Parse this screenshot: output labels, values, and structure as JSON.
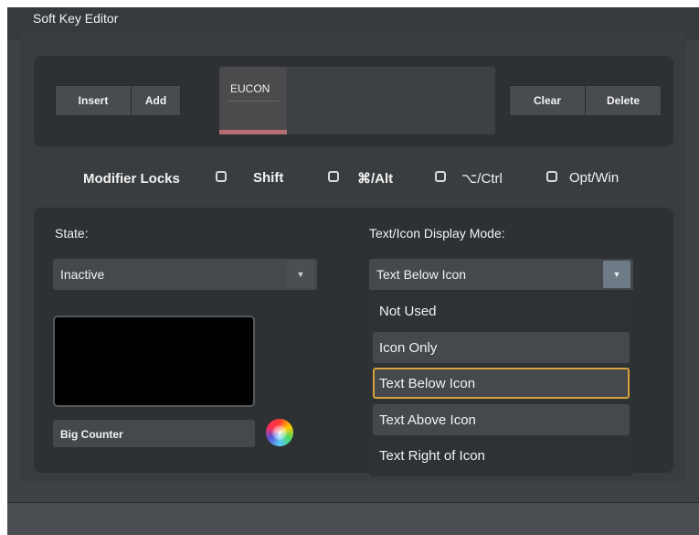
{
  "window": {
    "title": "Soft Key Editor"
  },
  "toolbar": {
    "insert_label": "Insert",
    "add_label": "Add",
    "clear_label": "Clear",
    "delete_label": "Delete"
  },
  "key_strip": {
    "active_key_label": "EUCON",
    "active_key_color": "#b56f74"
  },
  "modifier_locks": {
    "label": "Modifier Locks",
    "options": [
      {
        "label": "Shift",
        "checked": false
      },
      {
        "label": "⌘/Alt",
        "checked": false
      },
      {
        "label": "⌥/Ctrl",
        "checked": false
      },
      {
        "label": "Opt/Win",
        "checked": false
      }
    ]
  },
  "state": {
    "label": "State:",
    "value": "Inactive"
  },
  "display_mode": {
    "label": "Text/Icon Display Mode:",
    "value": "Text Below Icon",
    "options": [
      "Not Used",
      "Icon Only",
      "Text Below Icon",
      "Text Above Icon",
      "Text Right of Icon"
    ],
    "selected": "Text Below Icon"
  },
  "swatch": {
    "color": "#000000",
    "name_value": "Big Counter"
  },
  "colors": {
    "background": "#3e4145",
    "panel": "#2e3134",
    "accent_focus": "#d4a13a",
    "select_arrow_active": "#6e7a85"
  }
}
